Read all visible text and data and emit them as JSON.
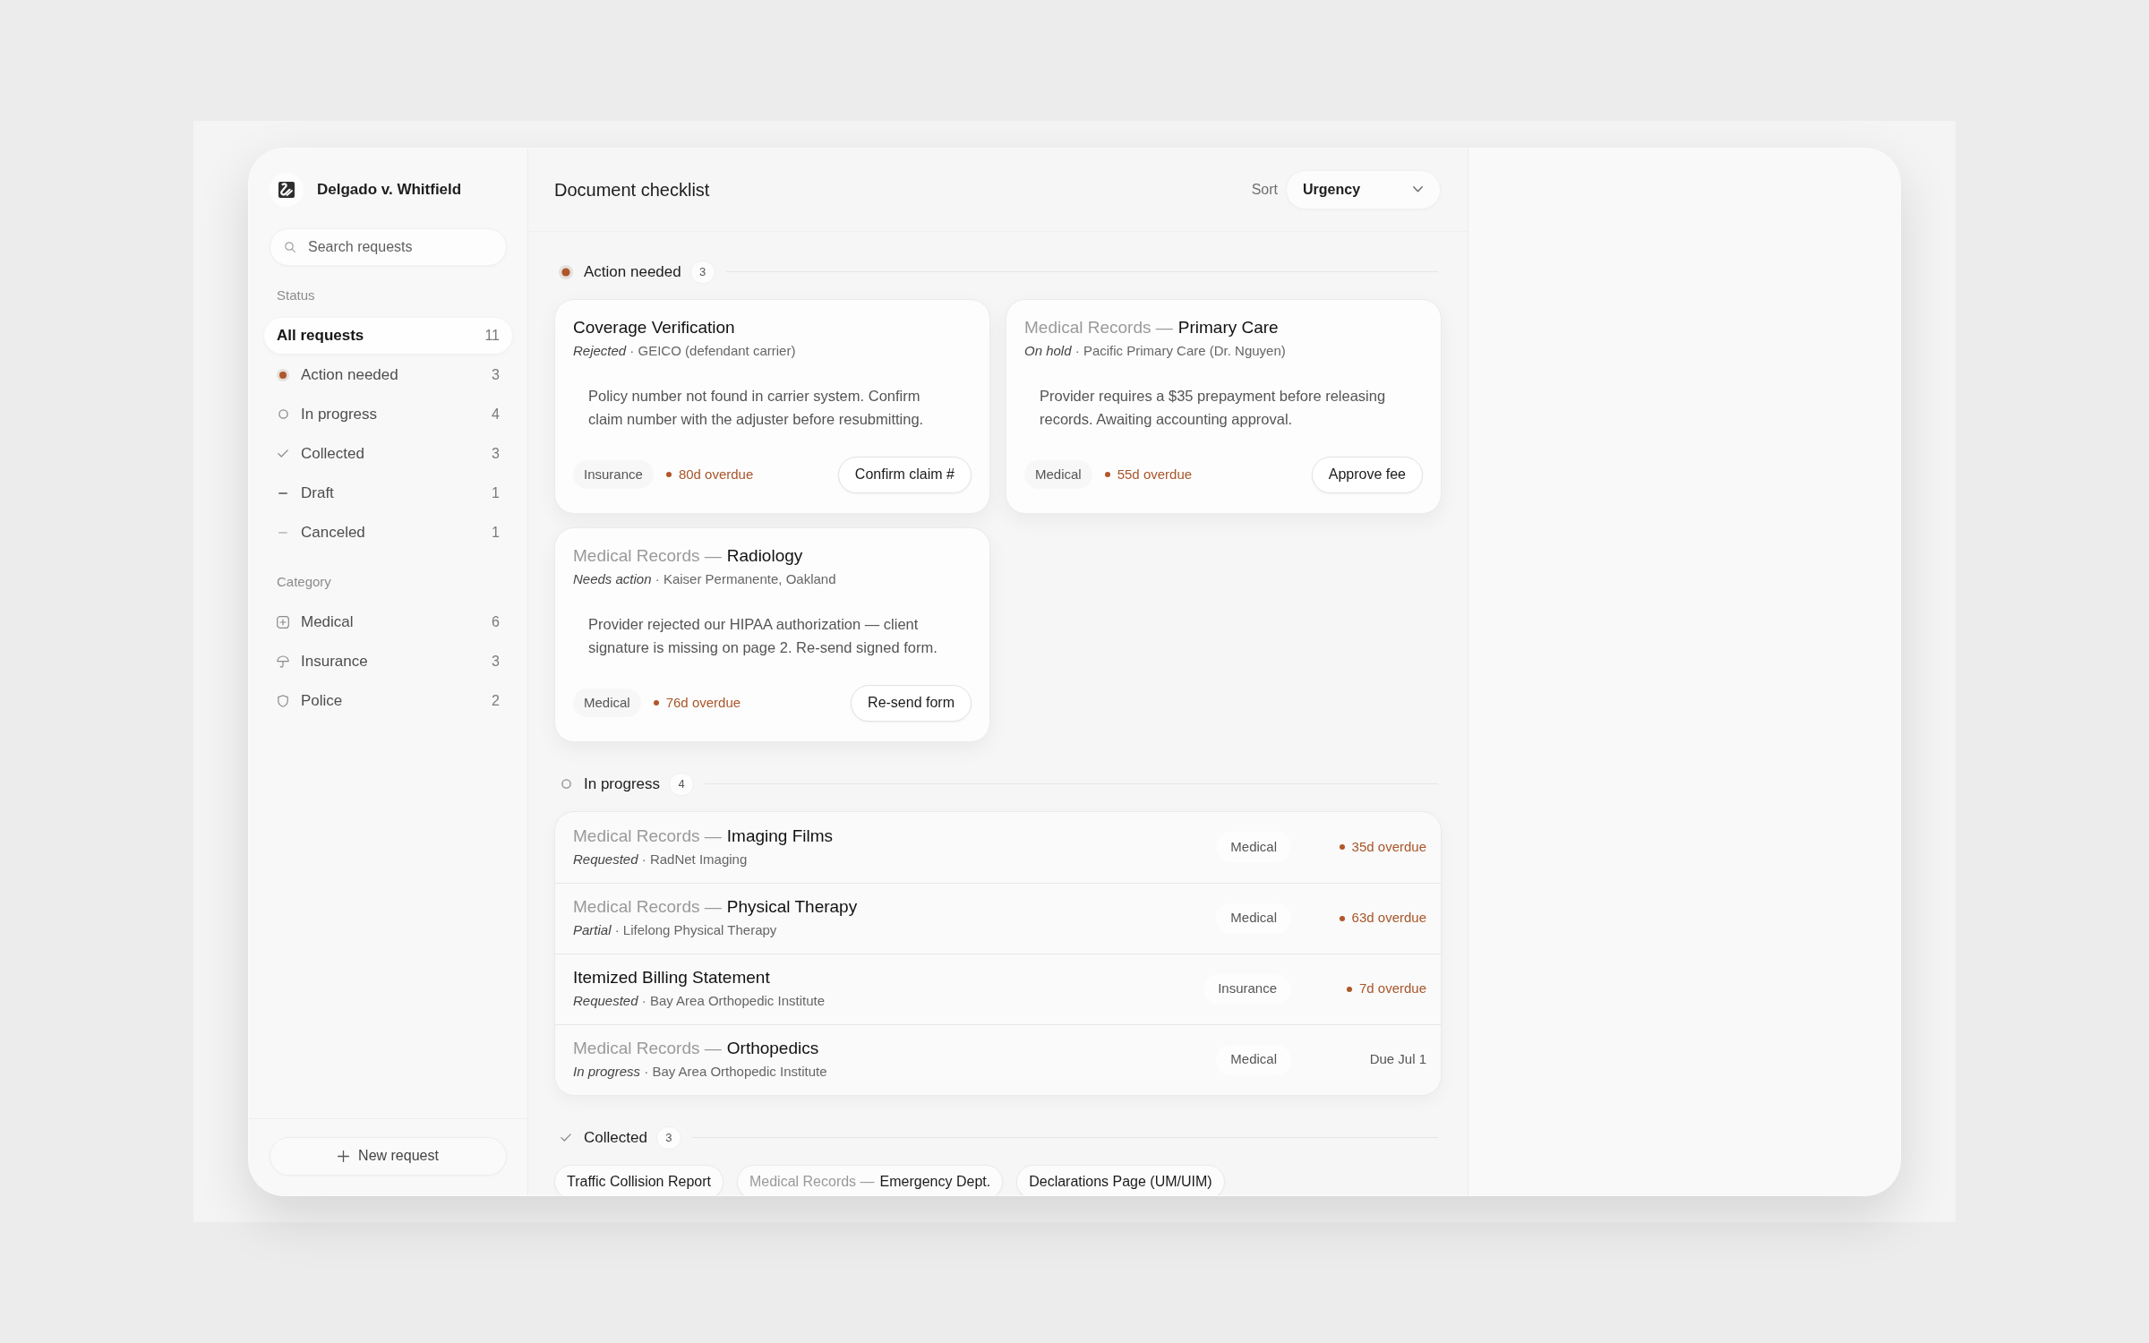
{
  "sidebar": {
    "case_title": "Delgado v. Whitfield",
    "search": {
      "placeholder": "Search requests"
    },
    "groups": [
      {
        "heading": "Status",
        "items": [
          {
            "kind": "all",
            "label": "All requests",
            "count": "11",
            "selected": true
          },
          {
            "kind": "action",
            "label": "Action needed",
            "count": "3",
            "selected": false
          },
          {
            "kind": "progress",
            "label": "In progress",
            "count": "4",
            "selected": false
          },
          {
            "kind": "collected",
            "label": "Collected",
            "count": "3",
            "selected": false
          },
          {
            "kind": "draft",
            "label": "Draft",
            "count": "1",
            "selected": false
          },
          {
            "kind": "canceled",
            "label": "Canceled",
            "count": "1",
            "selected": false
          }
        ]
      },
      {
        "heading": "Category",
        "items": [
          {
            "kind": "medical",
            "label": "Medical",
            "count": "6",
            "selected": false
          },
          {
            "kind": "insurance",
            "label": "Insurance",
            "count": "3",
            "selected": false
          },
          {
            "kind": "police",
            "label": "Police",
            "count": "2",
            "selected": false
          }
        ]
      }
    ],
    "new_request_button": "New request"
  },
  "header": {
    "title": "Document checklist",
    "sort_label": "Sort",
    "sort_value": "Urgency"
  },
  "sections": [
    {
      "kind": "action",
      "title": "Action needed",
      "count": "3",
      "items": [
        {
          "title": "Coverage Verification",
          "meta": "*Rejected* · GEICO (defendant carrier)",
          "note": "Policy number not found in carrier system. Confirm claim number with the adjuster before resubmitting.",
          "tag": "Insurance",
          "due": "80d overdue",
          "overdue": true,
          "action": "Confirm claim #"
        },
        {
          "title_prefix": "Medical Records —",
          "title": "Primary Care",
          "meta": "*On hold* · Pacific Primary Care (Dr. Nguyen)",
          "note": "Provider requires a $35 prepayment before releasing records. Awaiting accounting approval.",
          "tag": "Medical",
          "due": "55d overdue",
          "overdue": true,
          "action": "Approve fee"
        },
        {
          "title_prefix": "Medical Records —",
          "title": "Radiology",
          "meta": "*Needs action* · Kaiser Permanente, Oakland",
          "note": "Provider rejected our HIPAA authorization — client signature is missing on page 2. Re-send signed form.",
          "tag": "Medical",
          "due": "76d overdue",
          "overdue": true,
          "action": "Re-send form"
        }
      ]
    },
    {
      "kind": "progress",
      "title": "In progress",
      "count": "4",
      "items": [
        {
          "title_prefix": "Medical Records —",
          "title": "Imaging Films",
          "meta": "*Requested* · RadNet Imaging",
          "tag": "Medical",
          "due": "35d overdue",
          "overdue": true
        },
        {
          "title_prefix": "Medical Records —",
          "title": "Physical Therapy",
          "meta": "*Partial* · Lifelong Physical Therapy",
          "tag": "Medical",
          "due": "63d overdue",
          "overdue": true
        },
        {
          "title": "Itemized Billing Statement",
          "meta": "*Requested* · Bay Area Orthopedic Institute",
          "tag": "Insurance",
          "due": "7d overdue",
          "overdue": true
        },
        {
          "title_prefix": "Medical Records —",
          "title": "Orthopedics",
          "meta": "*In progress* · Bay Area Orthopedic Institute",
          "tag": "Medical",
          "due": "Due Jul 1",
          "overdue": false
        }
      ]
    },
    {
      "kind": "collected",
      "title": "Collected",
      "count": "3",
      "items": [
        {
          "title": "Traffic Collision Report"
        },
        {
          "title_prefix": "Medical Records —",
          "title": "Emergency Dept."
        },
        {
          "title": "Declarations Page (UM/UIM)"
        }
      ]
    }
  ]
}
